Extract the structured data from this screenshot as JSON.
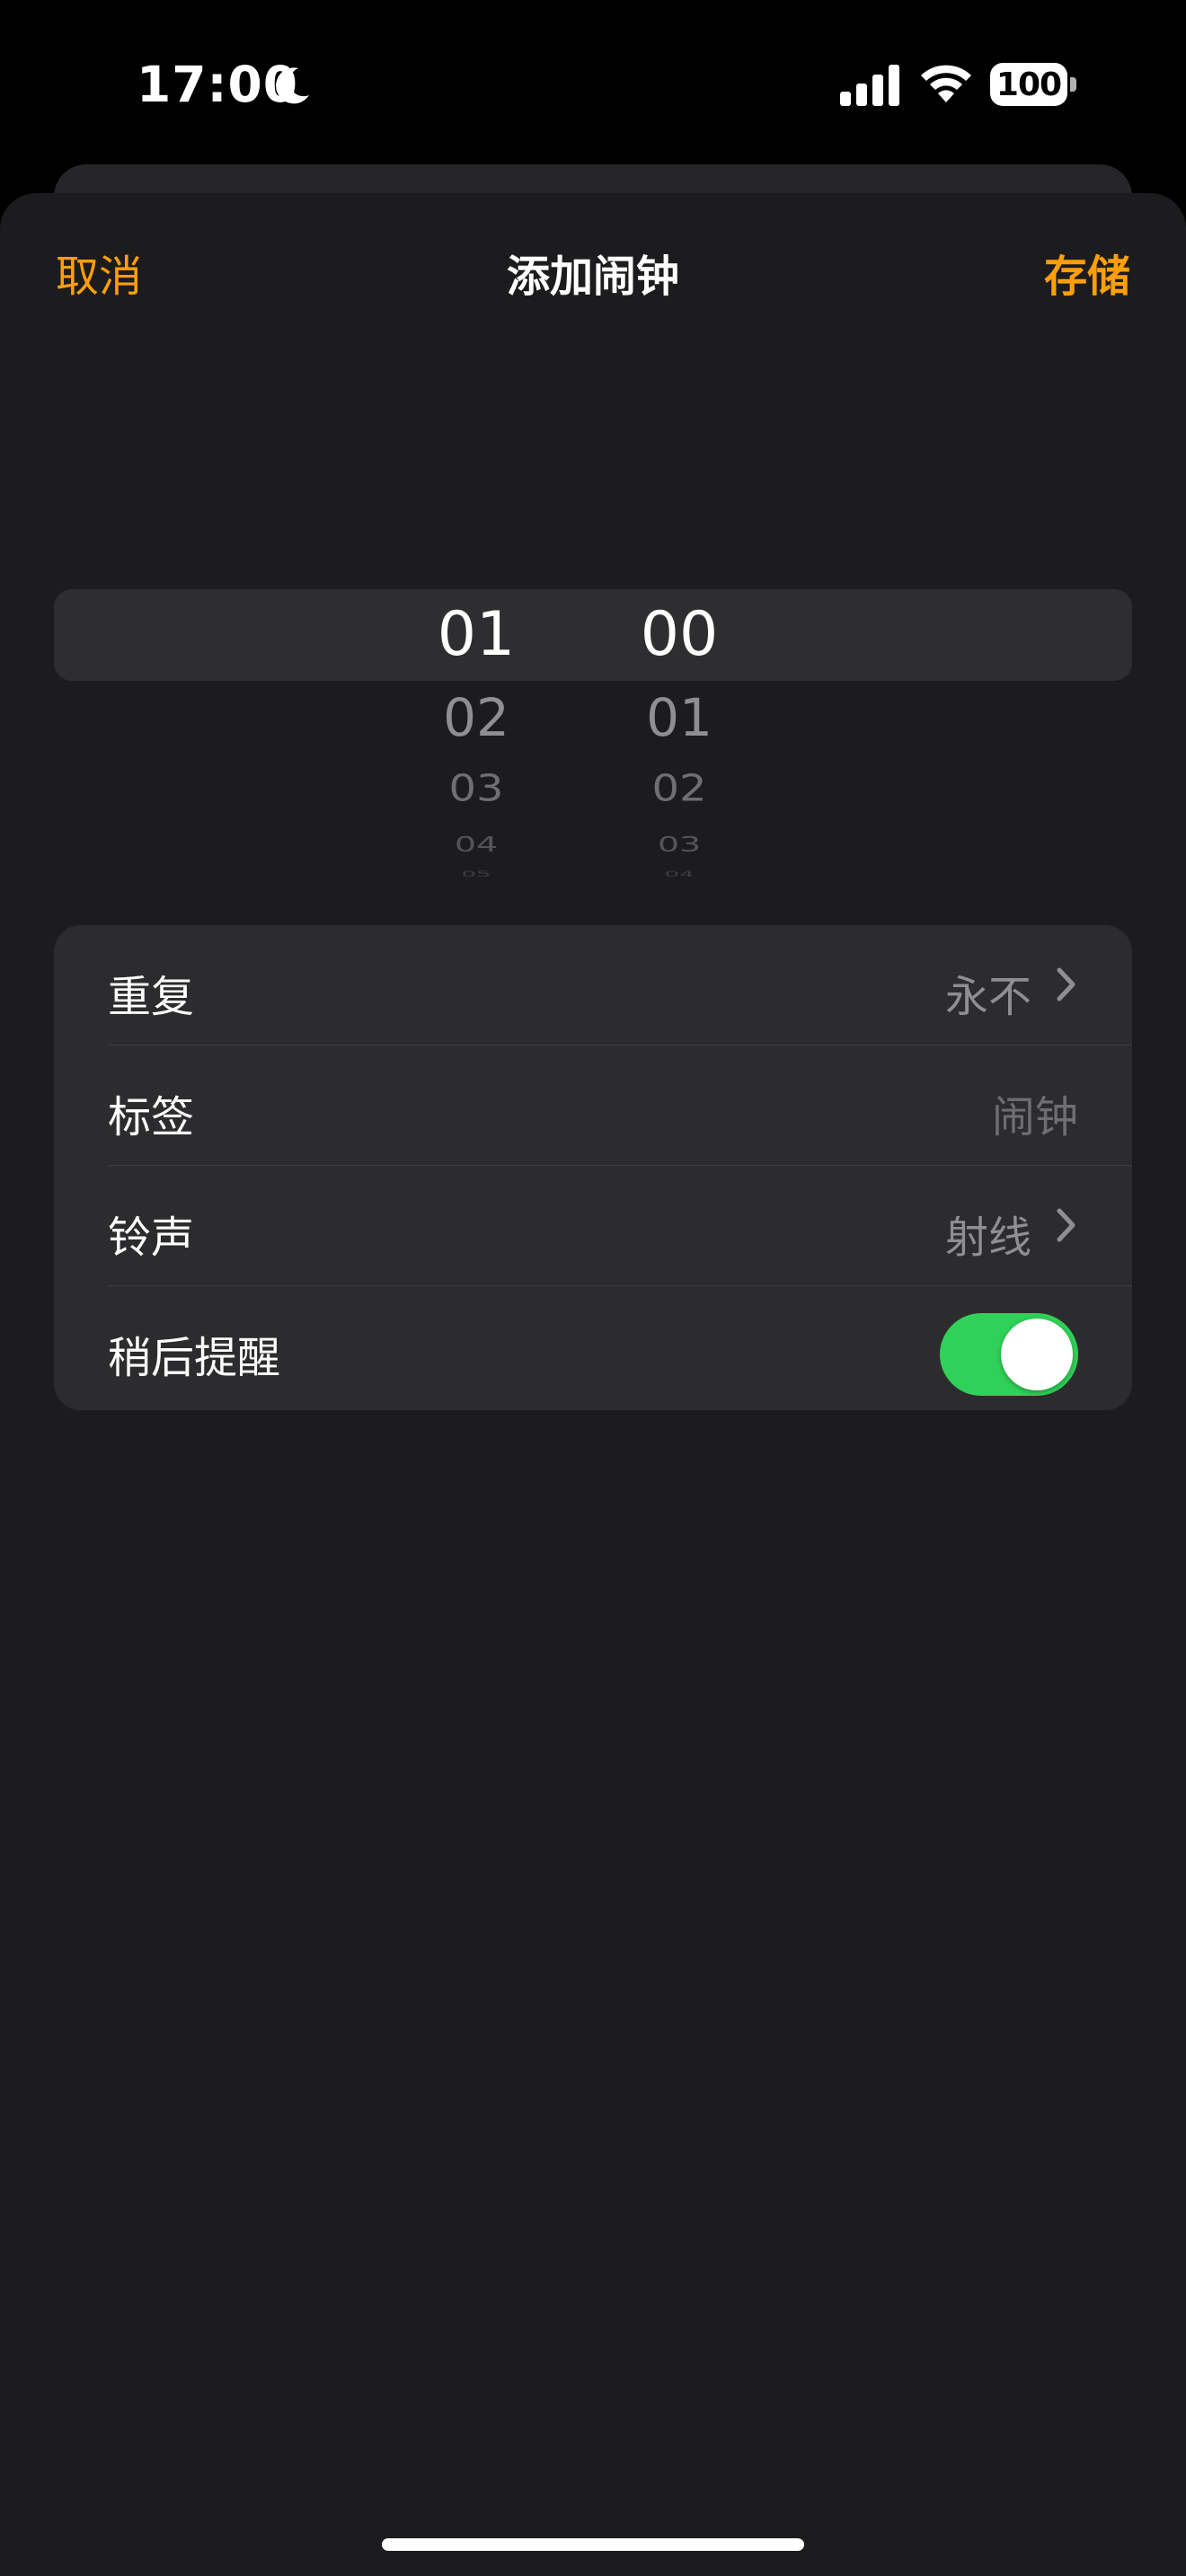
{
  "status_bar": {
    "time": "17:00",
    "battery": "100"
  },
  "nav": {
    "cancel_label": "取消",
    "title": "添加闹钟",
    "save_label": "存储"
  },
  "picker": {
    "hours": [
      "01",
      "02",
      "03",
      "04",
      "05"
    ],
    "minutes": [
      "00",
      "01",
      "02",
      "03",
      "04"
    ]
  },
  "settings": {
    "rows": [
      {
        "label": "重复",
        "value": "永不"
      },
      {
        "label": "标签",
        "value": "闹钟"
      },
      {
        "label": "铃声",
        "value": "射线"
      },
      {
        "label": "稍后提醒",
        "toggle_on": true
      }
    ]
  },
  "colors": {
    "accent": "#ff9f0a",
    "toggle_on": "#30d158",
    "sheet_background": "#1c1c1e",
    "group_background": "#2c2c2e"
  },
  "icons": [
    "moon-icon",
    "cellular-signal-icon",
    "wifi-icon",
    "battery-icon",
    "chevron-right-icon"
  ]
}
